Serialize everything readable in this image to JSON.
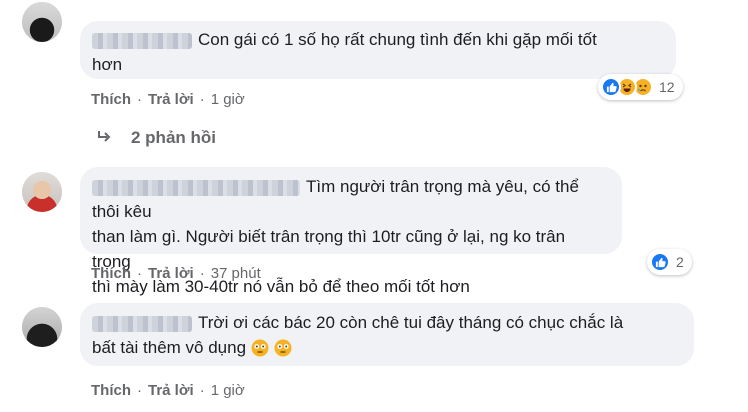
{
  "comments": [
    {
      "text_line1": "Con gái có 1 số họ rất chung tình đến khi gặp mối tốt",
      "text_line2": "hơn",
      "actions": {
        "like": "Thích",
        "reply": "Trả lời",
        "time": "1 giờ"
      },
      "reactions": {
        "icons": [
          "like-icon",
          "haha-icon",
          "sad-icon"
        ],
        "count": "12"
      },
      "replies_label": "2 phản hồi"
    },
    {
      "text_line1": "Tìm người trân trọng mà yêu, có thể thôi kêu",
      "text_line2": "than làm gì. Người biết trân trọng thì 10tr cũng ở lại, ng ko trân trọng",
      "text_line3": "thì mày làm 30-40tr nó vẫn bỏ để theo mối tốt hơn",
      "actions": {
        "like": "Thích",
        "reply": "Trả lời",
        "time": "37 phút"
      },
      "reactions": {
        "icons": [
          "like-icon"
        ],
        "count": "2"
      }
    },
    {
      "text_line1": "Trời ơi các bác 20 còn chê tui đây tháng có chục chắc là",
      "text_line2": "bất tài thêm vô dụng",
      "emojis": [
        "flushed-emoji",
        "flushed-emoji"
      ],
      "actions": {
        "like": "Thích",
        "reply": "Trả lời",
        "time": "1 giờ"
      }
    }
  ],
  "colors": {
    "like_blue": "#1877f2",
    "haha_yellow": "#f7b125",
    "bubble_bg": "#f0f2f5",
    "meta_gray": "#65676b"
  }
}
